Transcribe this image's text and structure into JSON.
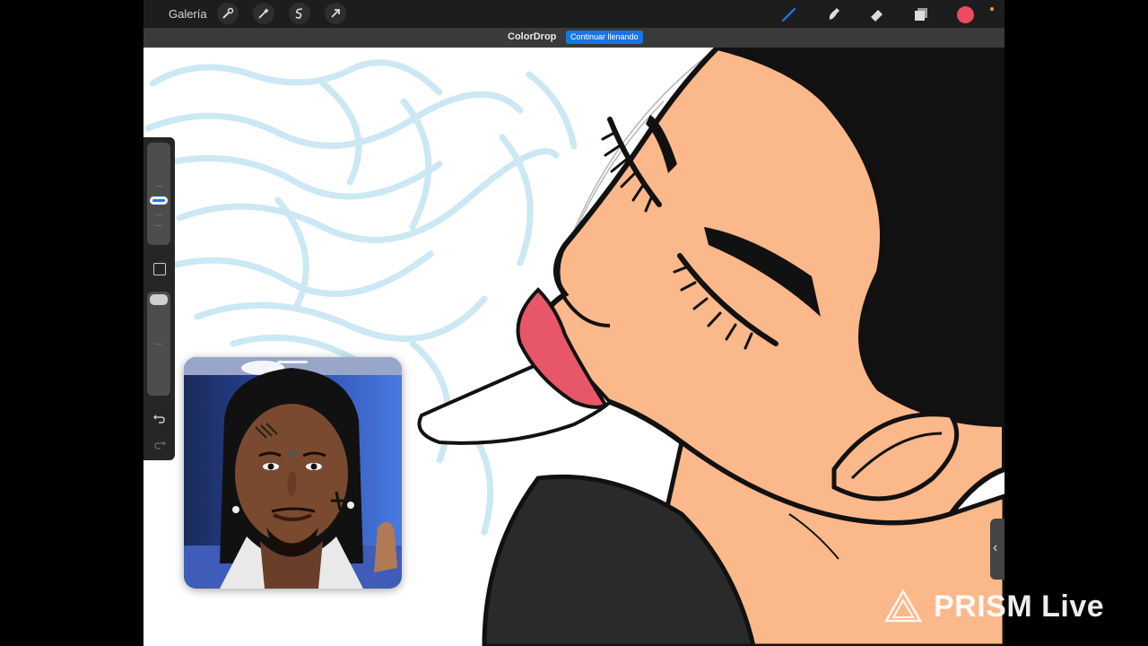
{
  "toolbar": {
    "gallery_label": "Galería",
    "left_icons": [
      "wrench-icon",
      "magic-wand-icon",
      "selection-icon",
      "transform-arrow-icon"
    ],
    "right_tools": [
      "brush-icon",
      "smudge-icon",
      "eraser-icon",
      "layers-icon",
      "color-swatch"
    ],
    "active_tool_color": "#1e7bf0",
    "current_color": "#ef4a5f"
  },
  "colordrop": {
    "title": "ColorDrop",
    "button_label": "Continuar llenando"
  },
  "sidebar": {
    "brush_size": 0.52,
    "opacity": 1.0,
    "icons": [
      "modify-square-icon",
      "undo-icon",
      "redo-icon"
    ]
  },
  "video_pip": {
    "subject": "person-webcam"
  },
  "watermark": {
    "text": "PRISM Live"
  },
  "colors": {
    "skin": "#fbb88b",
    "hair": "#121212",
    "lips": "#e8566a",
    "sketch": "#bfe3f0",
    "shirt": "#2a2a2a"
  }
}
